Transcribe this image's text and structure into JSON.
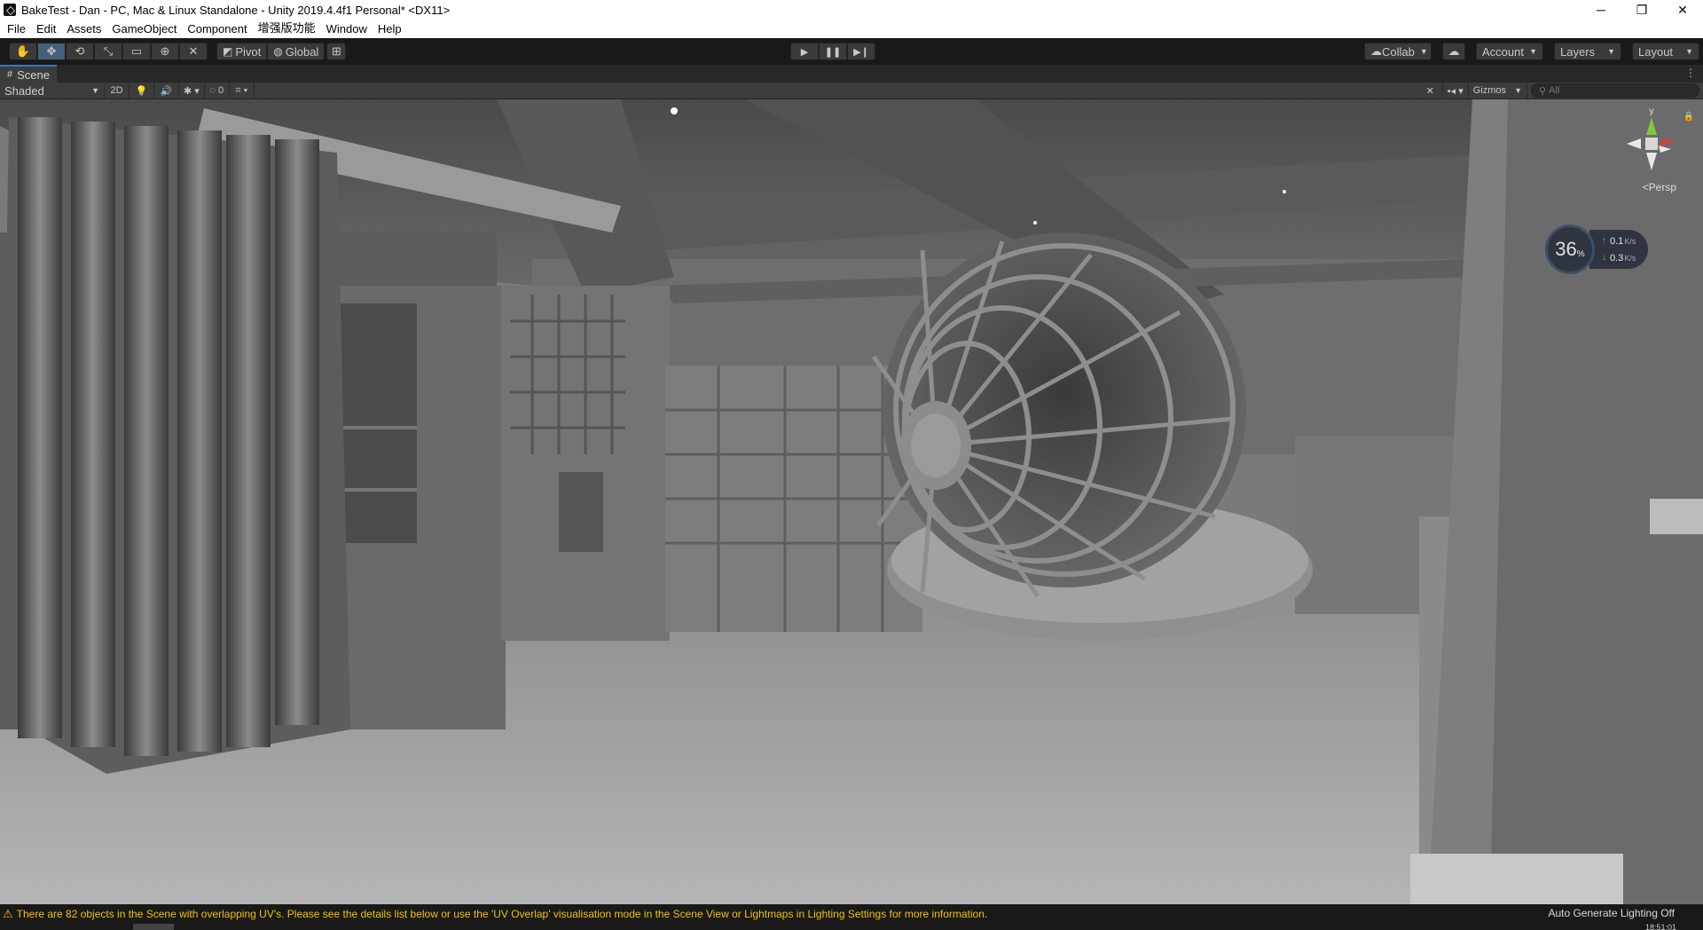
{
  "window": {
    "title": "BakeTest - Dan - PC, Mac & Linux Standalone - Unity 2019.4.4f1 Personal* <DX11>",
    "controls": {
      "minimize": "─",
      "restore": "❐",
      "close": "✕"
    }
  },
  "menu": [
    "File",
    "Edit",
    "Assets",
    "GameObject",
    "Component",
    "增强版功能",
    "Window",
    "Help"
  ],
  "toolbar": {
    "tools": [
      "hand-tool",
      "move-tool",
      "rotate-tool",
      "scale-tool",
      "rect-tool",
      "transform-tool",
      "custom-tool"
    ],
    "pivot_label": "Pivot",
    "global_label": "Global",
    "play_controls": [
      "play",
      "pause",
      "step"
    ],
    "collab_label": "Collab",
    "account_label": "Account",
    "layers_label": "Layers",
    "layout_label": "Layout"
  },
  "scene_tab": {
    "label": "Scene"
  },
  "scene_toolbar": {
    "draw_mode": "Shaded",
    "mode_2d": "2D",
    "hidden_count": "0",
    "gizmos_label": "Gizmos",
    "search_placeholder": "All"
  },
  "scene_view": {
    "persp_label": "Persp",
    "axis_y": "y",
    "accent_colors": {
      "x_axis": "#d0463a",
      "y_axis": "#7ec83a",
      "z_axis": "#3a7ed0"
    }
  },
  "network_widget": {
    "percent": "36",
    "percent_sign": "%",
    "upload": "0.1",
    "download": "0.3",
    "unit": "K/s"
  },
  "status": {
    "warning": "There are 82 objects in the Scene with overlapping UV's. Please see the details list below or use the 'UV Overlap' visualisation mode in the Scene View or Lightmaps in Lighting Settings for more information.",
    "lighting": "Auto Generate Lighting Off",
    "warning_color": "#f4c000"
  },
  "taskbar": {
    "clock": "18:51:01"
  }
}
